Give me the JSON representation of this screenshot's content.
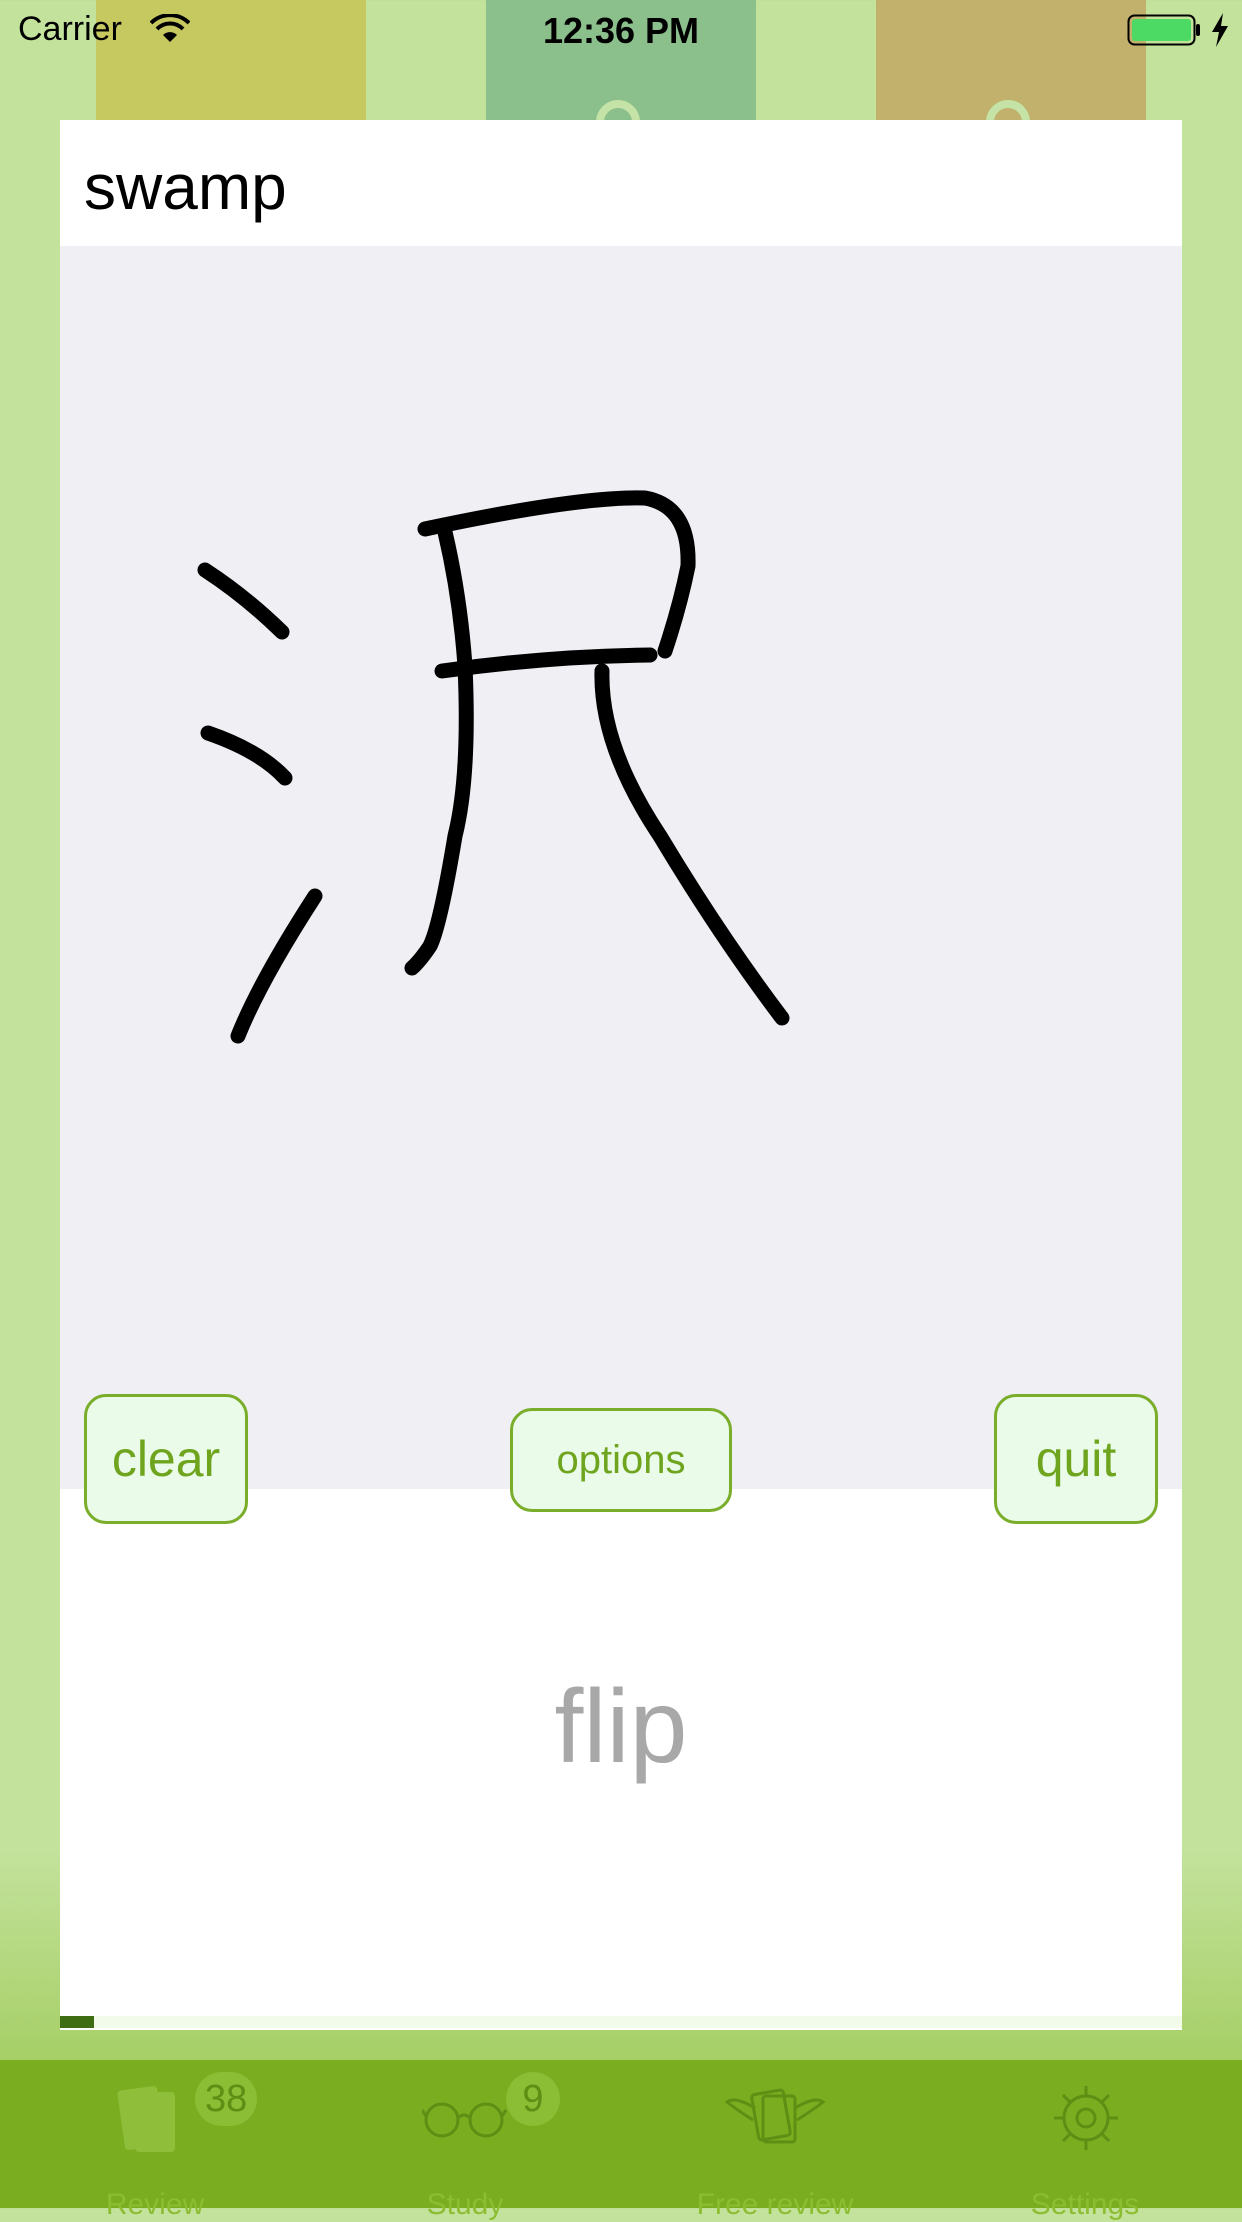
{
  "status_bar": {
    "carrier": "Carrier",
    "time": "12:36 PM"
  },
  "card": {
    "title": "swamp",
    "buttons": {
      "clear": "clear",
      "options": "options",
      "quit": "quit"
    },
    "flip_label": "flip",
    "progress_fraction": 0.03
  },
  "tab_bar": {
    "tabs": [
      {
        "label": "Review",
        "icon": "cards-icon",
        "badge": "38"
      },
      {
        "label": "Study",
        "icon": "glasses-icon",
        "badge": "9"
      },
      {
        "label": "Free review",
        "icon": "winged-cards-icon",
        "badge": ""
      },
      {
        "label": "Settings",
        "icon": "gear-icon",
        "badge": ""
      }
    ]
  },
  "colors": {
    "accent": "#7aad2a",
    "button_bg": "#eafbe9",
    "tab_bar": "#7aad1f",
    "background": "#c3e29c"
  }
}
